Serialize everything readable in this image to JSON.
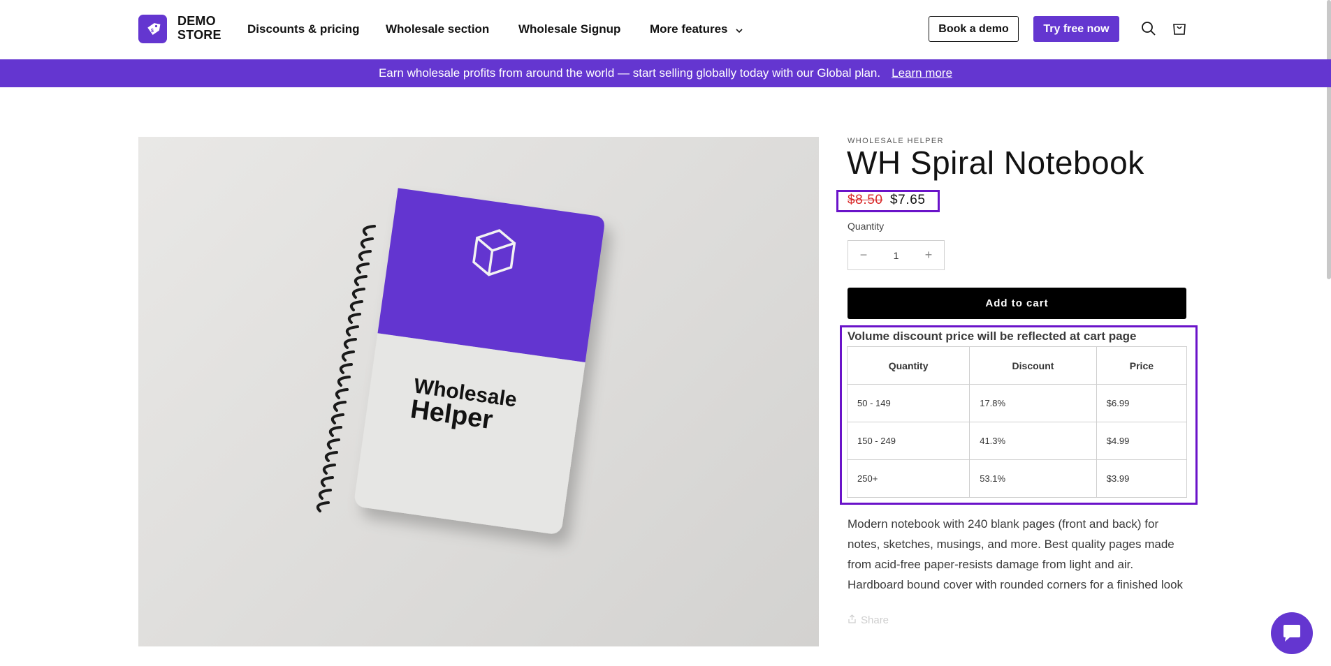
{
  "header": {
    "logo_line1": "DEMO",
    "logo_line2": "STORE",
    "nav": [
      "Discounts & pricing",
      "Wholesale section",
      "Wholesale Signup",
      "More features"
    ],
    "book_demo": "Book a demo",
    "try_free": "Try free now"
  },
  "banner": {
    "text": "Earn wholesale profits from around the world — start selling globally today with our Global plan.",
    "link": "Learn more"
  },
  "product": {
    "vendor": "WHOLESALE HELPER",
    "title": "WH Spiral Notebook",
    "old_price": "$8.50",
    "new_price": "$7.65",
    "quantity_label": "Quantity",
    "quantity_value": "1",
    "qty_minus": "−",
    "qty_plus": "+",
    "add_to_cart": "Add to cart",
    "image_text_1": "Wholesale",
    "image_text_2": "Helper",
    "description": "Modern notebook with 240 blank pages (front and back) for notes, sketches, musings, and more. Best quality pages made from acid-free paper-resists damage from light and air. Hardboard bound cover with rounded corners for a finished look",
    "share": "Share"
  },
  "volume_discount": {
    "heading": "Volume discount price will be reflected at cart page",
    "columns": [
      "Quantity",
      "Discount",
      "Price"
    ],
    "rows": [
      [
        "50 - 149",
        "17.8%",
        "$6.99"
      ],
      [
        "150 - 249",
        "41.3%",
        "$4.99"
      ],
      [
        "250+",
        "53.1%",
        "$3.99"
      ]
    ]
  },
  "colors": {
    "brand": "#6436d0",
    "highlight_border": "#6a13c9",
    "old_price": "#d92a2a"
  },
  "icons": [
    "logo-tag-icon",
    "chevron-down-icon",
    "search-icon",
    "cart-icon",
    "share-icon",
    "chat-icon",
    "box-logo-icon"
  ]
}
